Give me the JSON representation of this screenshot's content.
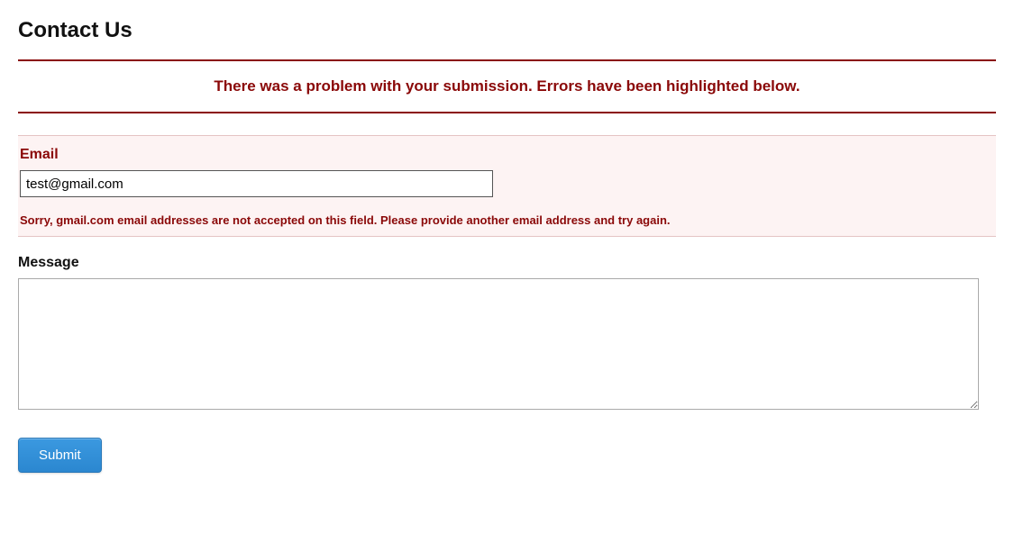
{
  "title": "Contact Us",
  "errorBanner": "There was a problem with your submission. Errors have been highlighted below.",
  "fields": {
    "email": {
      "label": "Email",
      "value": "test@gmail.com",
      "errorMsg": "Sorry, gmail.com email addresses are not accepted on this field. Please provide another email address and try again."
    },
    "message": {
      "label": "Message",
      "value": ""
    }
  },
  "submitLabel": "Submit"
}
